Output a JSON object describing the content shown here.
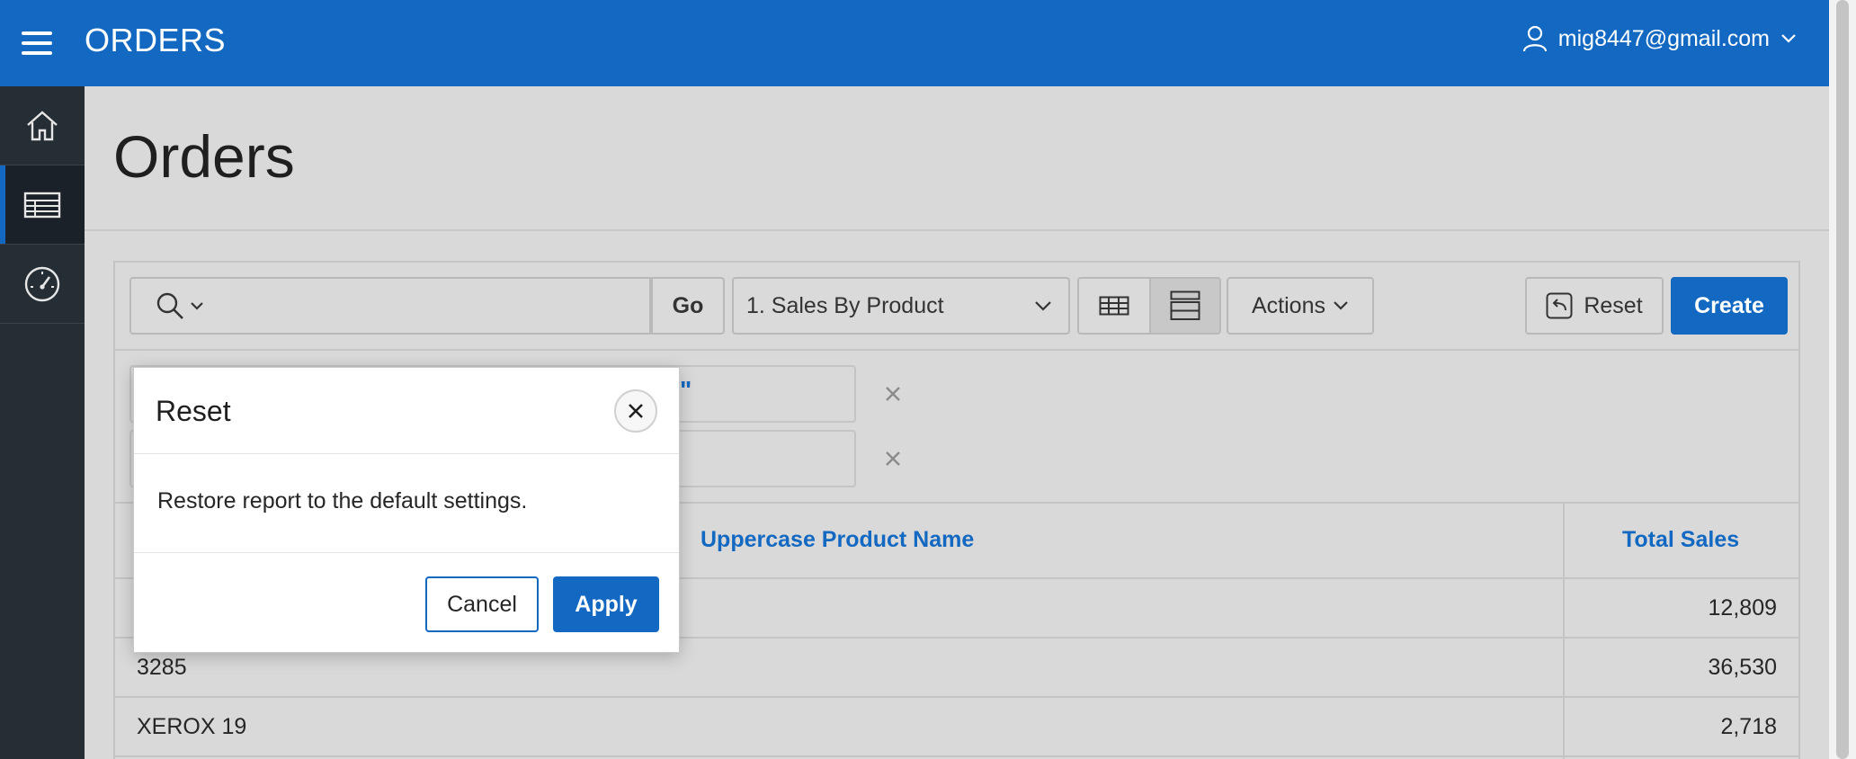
{
  "header": {
    "app_title": "ORDERS",
    "user": "mig8447@gmail.com"
  },
  "page": {
    "title": "Orders"
  },
  "toolbar": {
    "search_value": "",
    "go_label": "Go",
    "report_selected": "1. Sales By Product",
    "actions_label": "Actions",
    "reset_label": "Reset",
    "create_label": "Create"
  },
  "filters": {
    "quote_text": "\""
  },
  "table": {
    "columns": [
      "Uppercase Product Name",
      "Total Sales"
    ],
    "rows": [
      {
        "name": "",
        "sales": "12,809"
      },
      {
        "name": "3285",
        "sales": "36,530"
      },
      {
        "name": "XEROX 19",
        "sales": "2,718"
      }
    ]
  },
  "dialog": {
    "title": "Reset",
    "message": "Restore report to the default settings.",
    "cancel_label": "Cancel",
    "apply_label": "Apply"
  },
  "colors": {
    "brand": "#1369c2",
    "nav": "#252d35"
  }
}
